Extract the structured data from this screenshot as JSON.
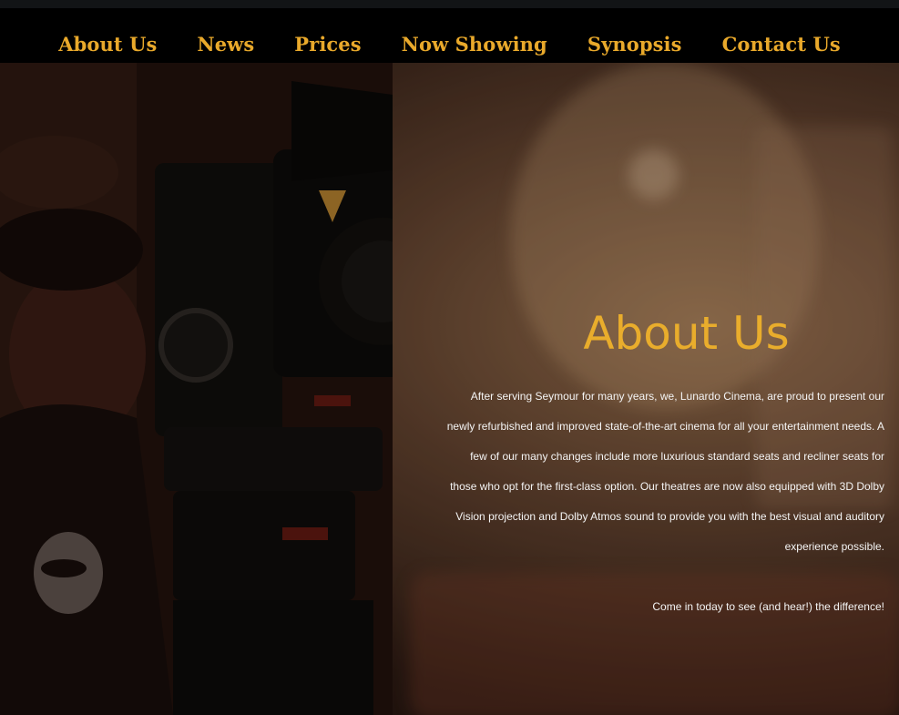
{
  "nav": {
    "items": [
      {
        "label": "About Us"
      },
      {
        "label": "News"
      },
      {
        "label": "Prices"
      },
      {
        "label": "Now Showing"
      },
      {
        "label": "Synopsis"
      },
      {
        "label": "Contact Us"
      }
    ]
  },
  "about": {
    "title": "About Us",
    "body": "After serving Seymour for many years, we, Lunardo Cinema, are proud to present our newly refurbished and improved state-of-the-art cinema for all your entertainment needs. A few of our many changes include more luxurious standard seats and recliner seats for those who opt for the first-class option. Our theatres are now also equipped with 3D Dolby Vision projection and Dolby Atmos sound to provide you with the best visual and auditory experience possible.",
    "cta": "Come in today to see (and hear!) the difference!"
  },
  "colors": {
    "accent": "#e9ad2c",
    "nav_bg": "#000000"
  },
  "hero_image": {
    "icon": "camera-operator-photo"
  }
}
